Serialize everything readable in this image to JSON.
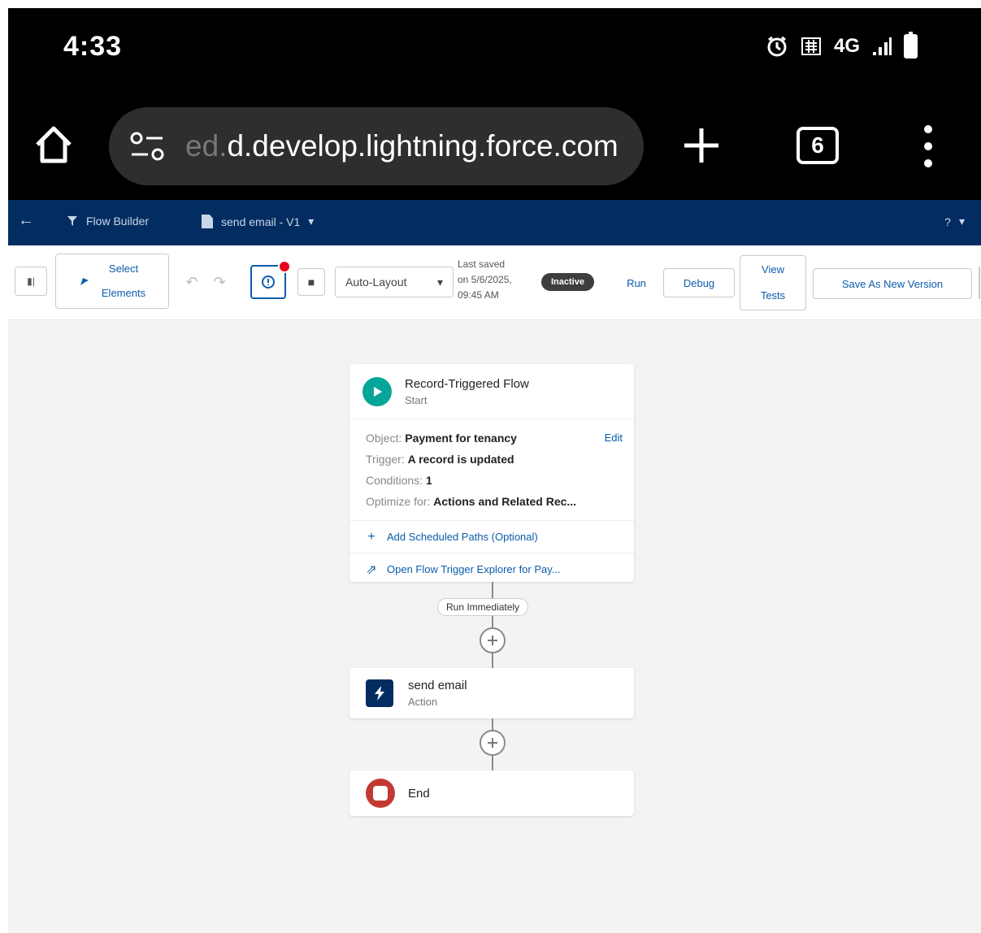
{
  "status_bar": {
    "time": "4:33",
    "network": "4G",
    "icons": [
      "alarm-icon",
      "hd-voice-icon",
      "signal-icon",
      "battery-icon"
    ]
  },
  "browser": {
    "url_prefix": "ed.",
    "url": "d.develop.lightning.force.com",
    "tab_count": "6",
    "icons": [
      "home-icon",
      "site-settings-icon",
      "plus-icon",
      "menu-icon"
    ]
  },
  "header": {
    "app_name": "Flow Builder",
    "flow_name": "send email - V1",
    "help_label": "?"
  },
  "toolbar": {
    "select_elements_line1": "Select",
    "select_elements_line2": "Elements",
    "layout_value": "Auto-Layout",
    "last_saved_line1": "Last saved",
    "last_saved_line2": "on 5/6/2025,",
    "last_saved_line3": "09:45 AM",
    "status_pill": "Inactive",
    "run_label": "Run",
    "debug_label": "Debug",
    "view_tests_line1": "View",
    "view_tests_line2": "Tests",
    "save_version_label": "Save As New Version"
  },
  "start_node": {
    "title": "Record-Triggered Flow",
    "subtitle": "Start",
    "edit_label": "Edit",
    "rows": [
      {
        "key": "Object:",
        "value": "Payment for tenancy"
      },
      {
        "key": "Trigger:",
        "value": "A record is updated"
      },
      {
        "key": "Conditions:",
        "value": "1"
      },
      {
        "key": "Optimize for:",
        "value": "Actions and Related Rec..."
      }
    ],
    "link_scheduled": "Add Scheduled Paths (Optional)",
    "link_explorer": "Open Flow Trigger Explorer for Pay..."
  },
  "path_label": "Run Immediately",
  "action_node": {
    "title": "send email",
    "subtitle": "Action"
  },
  "end_node": {
    "title": "End"
  },
  "colors": {
    "sf_header": "#032d60",
    "link_blue": "#0b5cab",
    "start_teal": "#06a59a",
    "end_red": "#c23934",
    "canvas_bg": "#f3f3f3"
  }
}
